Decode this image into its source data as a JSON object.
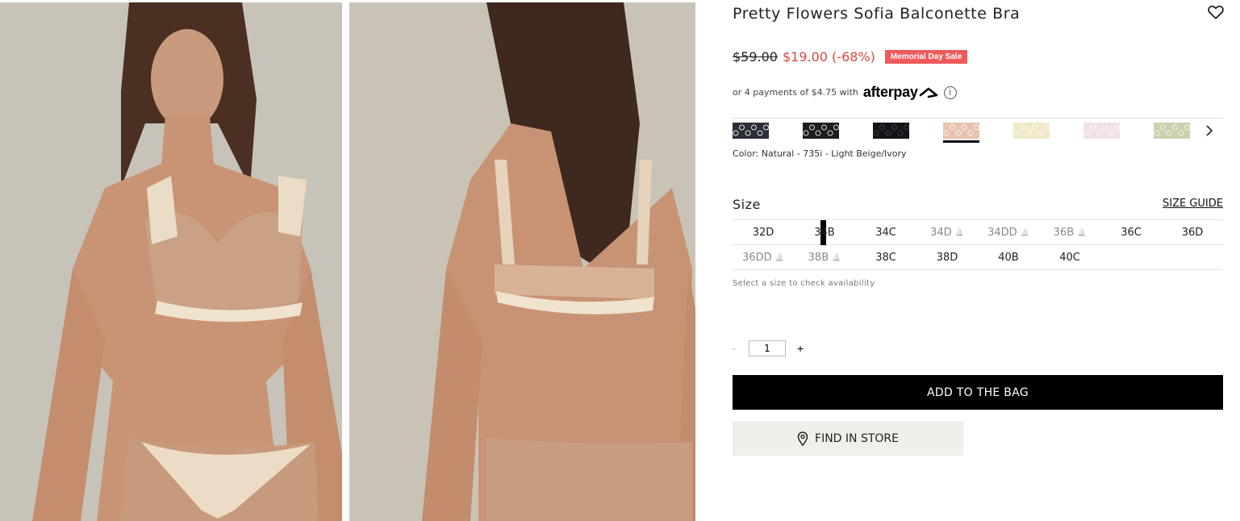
{
  "product": {
    "title": "Pretty Flowers Sofia Balconette Bra",
    "old_price": "$59.00",
    "new_price": "$19.00 (-68%)",
    "sale_badge": "Memorial Day Sale",
    "installments_text": "or 4 payments of $4.75 with",
    "afterpay_label": "afterpay",
    "info_glyph": "i"
  },
  "colors": {
    "selected_label": "Color: Natural - 735i - Light Beige/Ivory",
    "swatches": [
      {
        "name": "navy-black-lace",
        "bg": "#2b2f3a",
        "fg": "#e8e4da"
      },
      {
        "name": "black-floral",
        "bg": "#1d1d1d",
        "fg": "#d9d6cf"
      },
      {
        "name": "black",
        "bg": "#121418",
        "fg": "#3a3d44"
      },
      {
        "name": "natural",
        "bg": "#e7c3ae",
        "fg": "#fbf3ea",
        "selected": true
      },
      {
        "name": "ivory-yellow",
        "bg": "#efe9c9",
        "fg": "#fbf8ea"
      },
      {
        "name": "pink-white",
        "bg": "#efe1e6",
        "fg": "#fbf6f8"
      },
      {
        "name": "sage",
        "bg": "#c9d2ae",
        "fg": "#eef1e2"
      }
    ]
  },
  "sizes": {
    "title": "Size",
    "guide_label": "SIZE GUIDE",
    "note": "Select a size to check availability",
    "items": [
      {
        "label": "32D",
        "oos": false
      },
      {
        "label": "34B",
        "oos": false,
        "focused": true
      },
      {
        "label": "34C",
        "oos": false
      },
      {
        "label": "34D",
        "oos": true
      },
      {
        "label": "34DD",
        "oos": true
      },
      {
        "label": "36B",
        "oos": true
      },
      {
        "label": "36C",
        "oos": false
      },
      {
        "label": "36D",
        "oos": false
      },
      {
        "label": "36DD",
        "oos": true
      },
      {
        "label": "38B",
        "oos": true
      },
      {
        "label": "38C",
        "oos": false
      },
      {
        "label": "38D",
        "oos": false
      },
      {
        "label": "40B",
        "oos": false
      },
      {
        "label": "40C",
        "oos": false
      }
    ]
  },
  "quantity": {
    "minus": "-",
    "value": "1",
    "plus": "+"
  },
  "actions": {
    "add_to_bag": "ADD TO THE BAG",
    "find_in_store": "FIND IN STORE"
  },
  "theme": {
    "sale_red": "#d9473f",
    "badge_red": "#f05a5a",
    "button_black": "#000000",
    "store_bg": "#f1efe9"
  }
}
